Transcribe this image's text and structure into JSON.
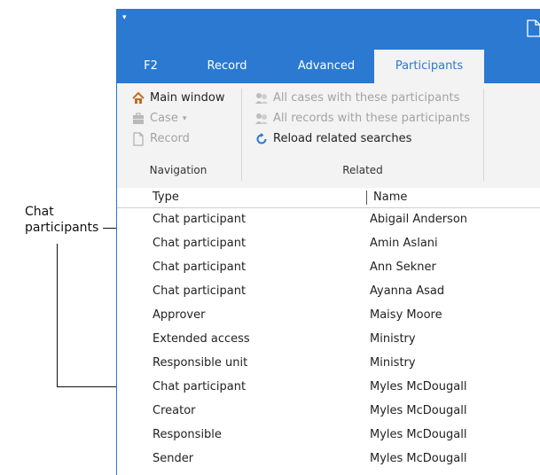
{
  "annotation": {
    "label_line1": "Chat",
    "label_line2": "participants"
  },
  "tabs": [
    {
      "label": "F2"
    },
    {
      "label": "Record"
    },
    {
      "label": "Advanced"
    },
    {
      "label": "Participants"
    }
  ],
  "ribbon": {
    "navigation": {
      "main_window": "Main window",
      "case": "Case",
      "case_arrow": "▾",
      "record": "Record",
      "group_label": "Navigation"
    },
    "related": {
      "all_cases": "All cases with these participants",
      "all_records": "All records with these participants",
      "reload": "Reload related searches",
      "group_label": "Related"
    }
  },
  "table": {
    "headers": {
      "type": "Type",
      "name": "Name"
    },
    "rows": [
      {
        "type": "Chat participant",
        "name": "Abigail Anderson"
      },
      {
        "type": "Chat participant",
        "name": "Amin Aslani"
      },
      {
        "type": "Chat participant",
        "name": "Ann Sekner"
      },
      {
        "type": "Chat participant",
        "name": "Ayanna Asad"
      },
      {
        "type": "Approver",
        "name": "Maisy Moore"
      },
      {
        "type": "Extended access",
        "name": "Ministry"
      },
      {
        "type": "Responsible unit",
        "name": "Ministry"
      },
      {
        "type": "Chat participant",
        "name": "Myles McDougall"
      },
      {
        "type": "Creator",
        "name": "Myles McDougall"
      },
      {
        "type": "Responsible",
        "name": "Myles McDougall"
      },
      {
        "type": "Sender",
        "name": "Myles McDougall"
      }
    ]
  },
  "colors": {
    "titlebar": "#2b79d1",
    "ribbon": "#f3f3f3",
    "active_tab_text": "#2b79d1"
  },
  "icons": [
    "quick-access-arrow-icon",
    "document-icon",
    "home-icon",
    "case-icon",
    "record-icon",
    "participants-icon",
    "reload-icon"
  ]
}
